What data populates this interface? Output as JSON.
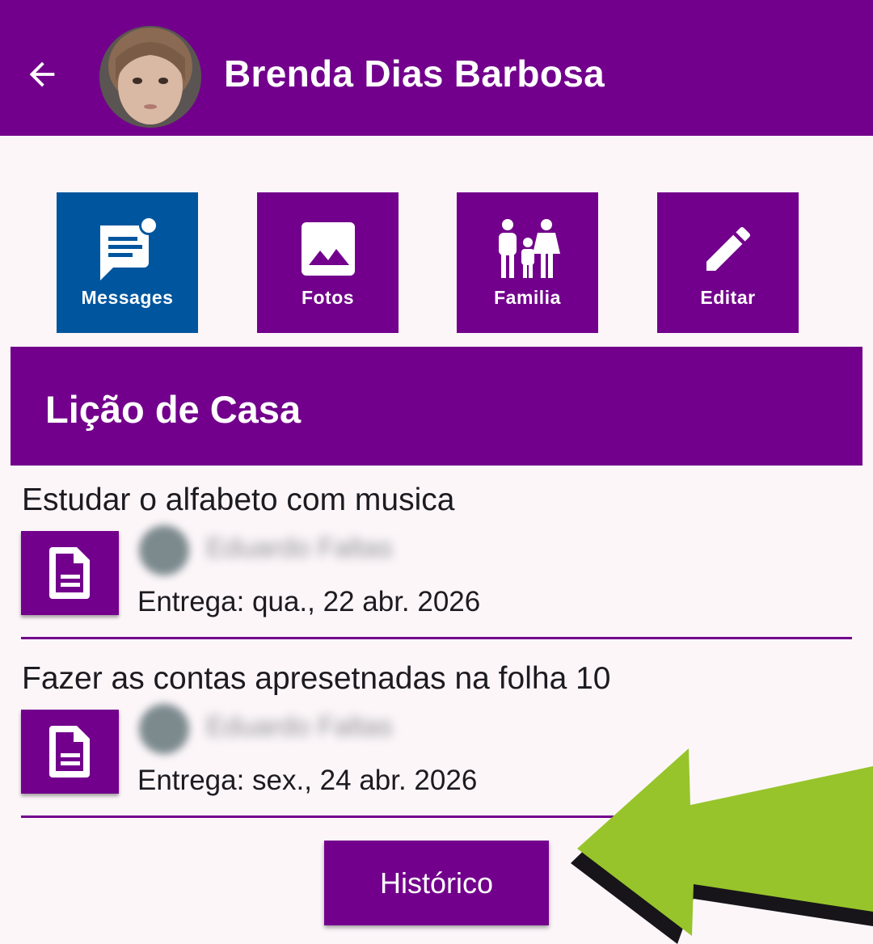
{
  "appbar": {
    "title": "Brenda Dias Barbosa",
    "back_icon": "arrow-back-icon",
    "color": "#72008c"
  },
  "tiles": [
    {
      "label": "Messages",
      "icon": "message-icon",
      "color": "#00569e",
      "active": true
    },
    {
      "label": "Fotos",
      "icon": "image-icon",
      "color": "#72008c"
    },
    {
      "label": "Familia",
      "icon": "family-icon",
      "color": "#72008c"
    },
    {
      "label": "Editar",
      "icon": "pencil-icon",
      "color": "#72008c"
    }
  ],
  "section": {
    "title": "Lição de Casa"
  },
  "homework": [
    {
      "title": "Estudar o alfabeto com musica",
      "teacher": "Eduardo Faltas",
      "due": "Entrega: qua., 22 abr. 2026"
    },
    {
      "title": "Fazer as contas apresetnadas na folha 10",
      "teacher": "Eduardo Faltas",
      "due": "Entrega: sex., 24 abr. 2026"
    }
  ],
  "history_button": {
    "label": "Histórico"
  },
  "colors": {
    "primary": "#72008c",
    "accent_blue": "#00569e",
    "arrow_green": "#97c42a",
    "background": "#fcf6f9"
  }
}
